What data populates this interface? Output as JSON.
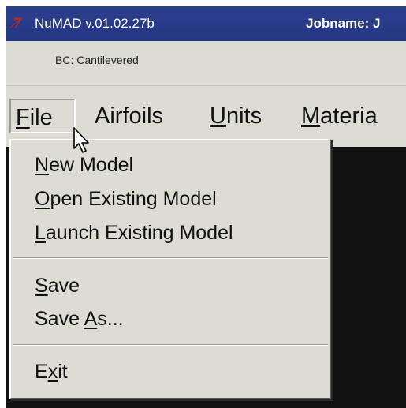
{
  "window": {
    "app_icon_glyph": "7̸",
    "app_title": "NuMAD v.01.02.27b",
    "jobname_label": "Jobname: J"
  },
  "status": {
    "bc_label": "BC: Cantilevered"
  },
  "menu_bar": {
    "file": {
      "mnemonic": "F",
      "rest": "ile"
    },
    "airfoils": {
      "mnemonic": "",
      "rest": "Airfoils"
    },
    "units": {
      "mnemonic": "U",
      "rest": "nits"
    },
    "materials": {
      "mnemonic": "M",
      "rest": "ateria"
    }
  },
  "file_menu": {
    "new_model": {
      "before": "",
      "mnemonic": "N",
      "after": "ew Model"
    },
    "open_model": {
      "before": "",
      "mnemonic": "O",
      "after": "pen Existing Model"
    },
    "launch_model": {
      "before": "",
      "mnemonic": "L",
      "after": "aunch Existing Model"
    },
    "save": {
      "before": "",
      "mnemonic": "S",
      "after": "ave"
    },
    "save_as": {
      "before": "Save ",
      "mnemonic": "A",
      "after": "s..."
    },
    "exit": {
      "before": "E",
      "mnemonic": "x",
      "after": "it"
    }
  },
  "colors": {
    "title_bar": "#253682",
    "window_background": "#dcdcd4",
    "canvas": "#121212",
    "icon_accent": "#c2281e"
  },
  "icons": {
    "app_icon": "numad-logo-icon",
    "cursor": "mouse-pointer-icon"
  }
}
